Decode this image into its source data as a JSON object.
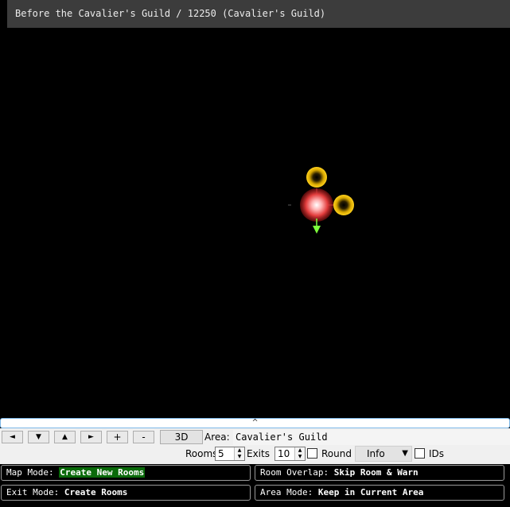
{
  "window": {
    "title": "Before the Cavalier's Guild / 12250 (Cavalier's Guild)"
  },
  "colors": {
    "room_yellow": "#ffd21e",
    "room_current": "#e23c3c",
    "exit_green": "#7dff3c",
    "background": "#000000"
  },
  "splitter": {
    "label": "^"
  },
  "toolbar": {
    "nav": {
      "left": "◄",
      "down": "▼",
      "up": "▲",
      "right": "►",
      "plus": "+",
      "minus": "-"
    },
    "view_3d": "3D",
    "area_label": "Area:",
    "area_value": "Cavalier's Guild",
    "rooms_label": "Rooms",
    "rooms_value": "5",
    "exits_label": "Exits",
    "exits_value": "10",
    "round_label": "Round",
    "round_checked": false,
    "info_value": "Info",
    "ids_label": "IDs",
    "ids_checked": false
  },
  "status": {
    "map_mode_label": "Map Mode:",
    "map_mode_value": "Create New Rooms",
    "room_overlap_label": "Room Overlap:",
    "room_overlap_value": "Skip Room & Warn",
    "exit_mode_label": "Exit Mode:",
    "exit_mode_value": "Create Rooms",
    "area_mode_label": "Area Mode:",
    "area_mode_value": "Keep in Current Area"
  }
}
